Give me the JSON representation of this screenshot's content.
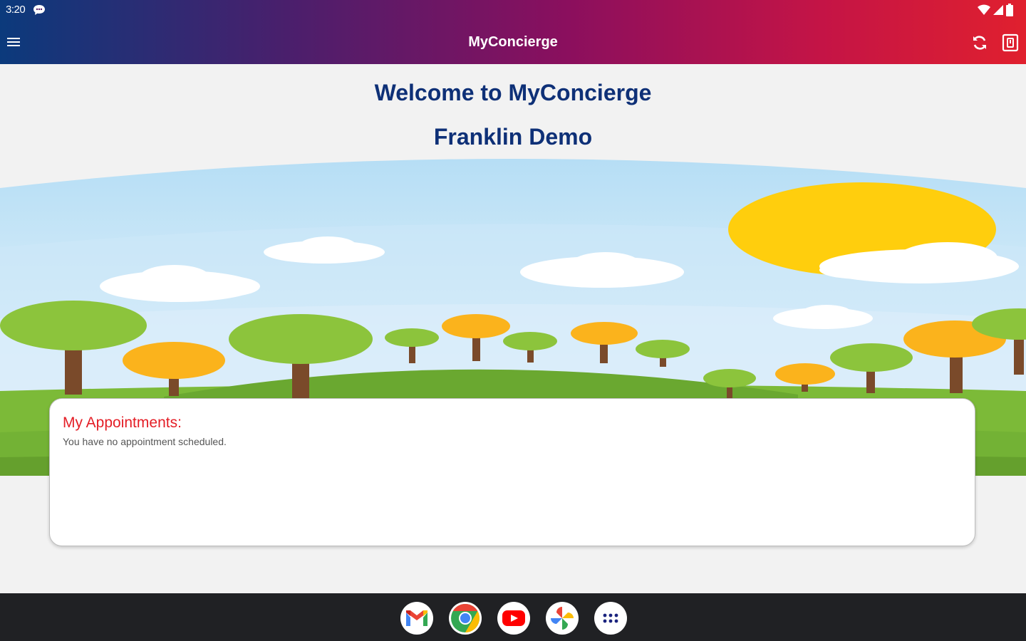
{
  "status_bar": {
    "time": "3:20"
  },
  "app_bar": {
    "title": "MyConcierge"
  },
  "header": {
    "welcome": "Welcome to MyConcierge",
    "organization": "Franklin Demo"
  },
  "appointments": {
    "title": "My Appointments:",
    "empty_message": "You have no appointment scheduled."
  },
  "icons": {
    "menu": "menu-icon",
    "refresh": "refresh-icon",
    "logout": "logout-icon",
    "wifi": "wifi-icon",
    "signal": "signal-icon",
    "battery": "battery-icon",
    "chat": "chat-icon"
  },
  "dock": [
    "Gmail",
    "Chrome",
    "YouTube",
    "Photos",
    "App launcher"
  ],
  "colors": {
    "title_blue": "#0e3077",
    "accent_red": "#e41e26",
    "appbar_gradient": [
      "#0b3a7c",
      "#8a0f5e",
      "#e0202e"
    ]
  }
}
